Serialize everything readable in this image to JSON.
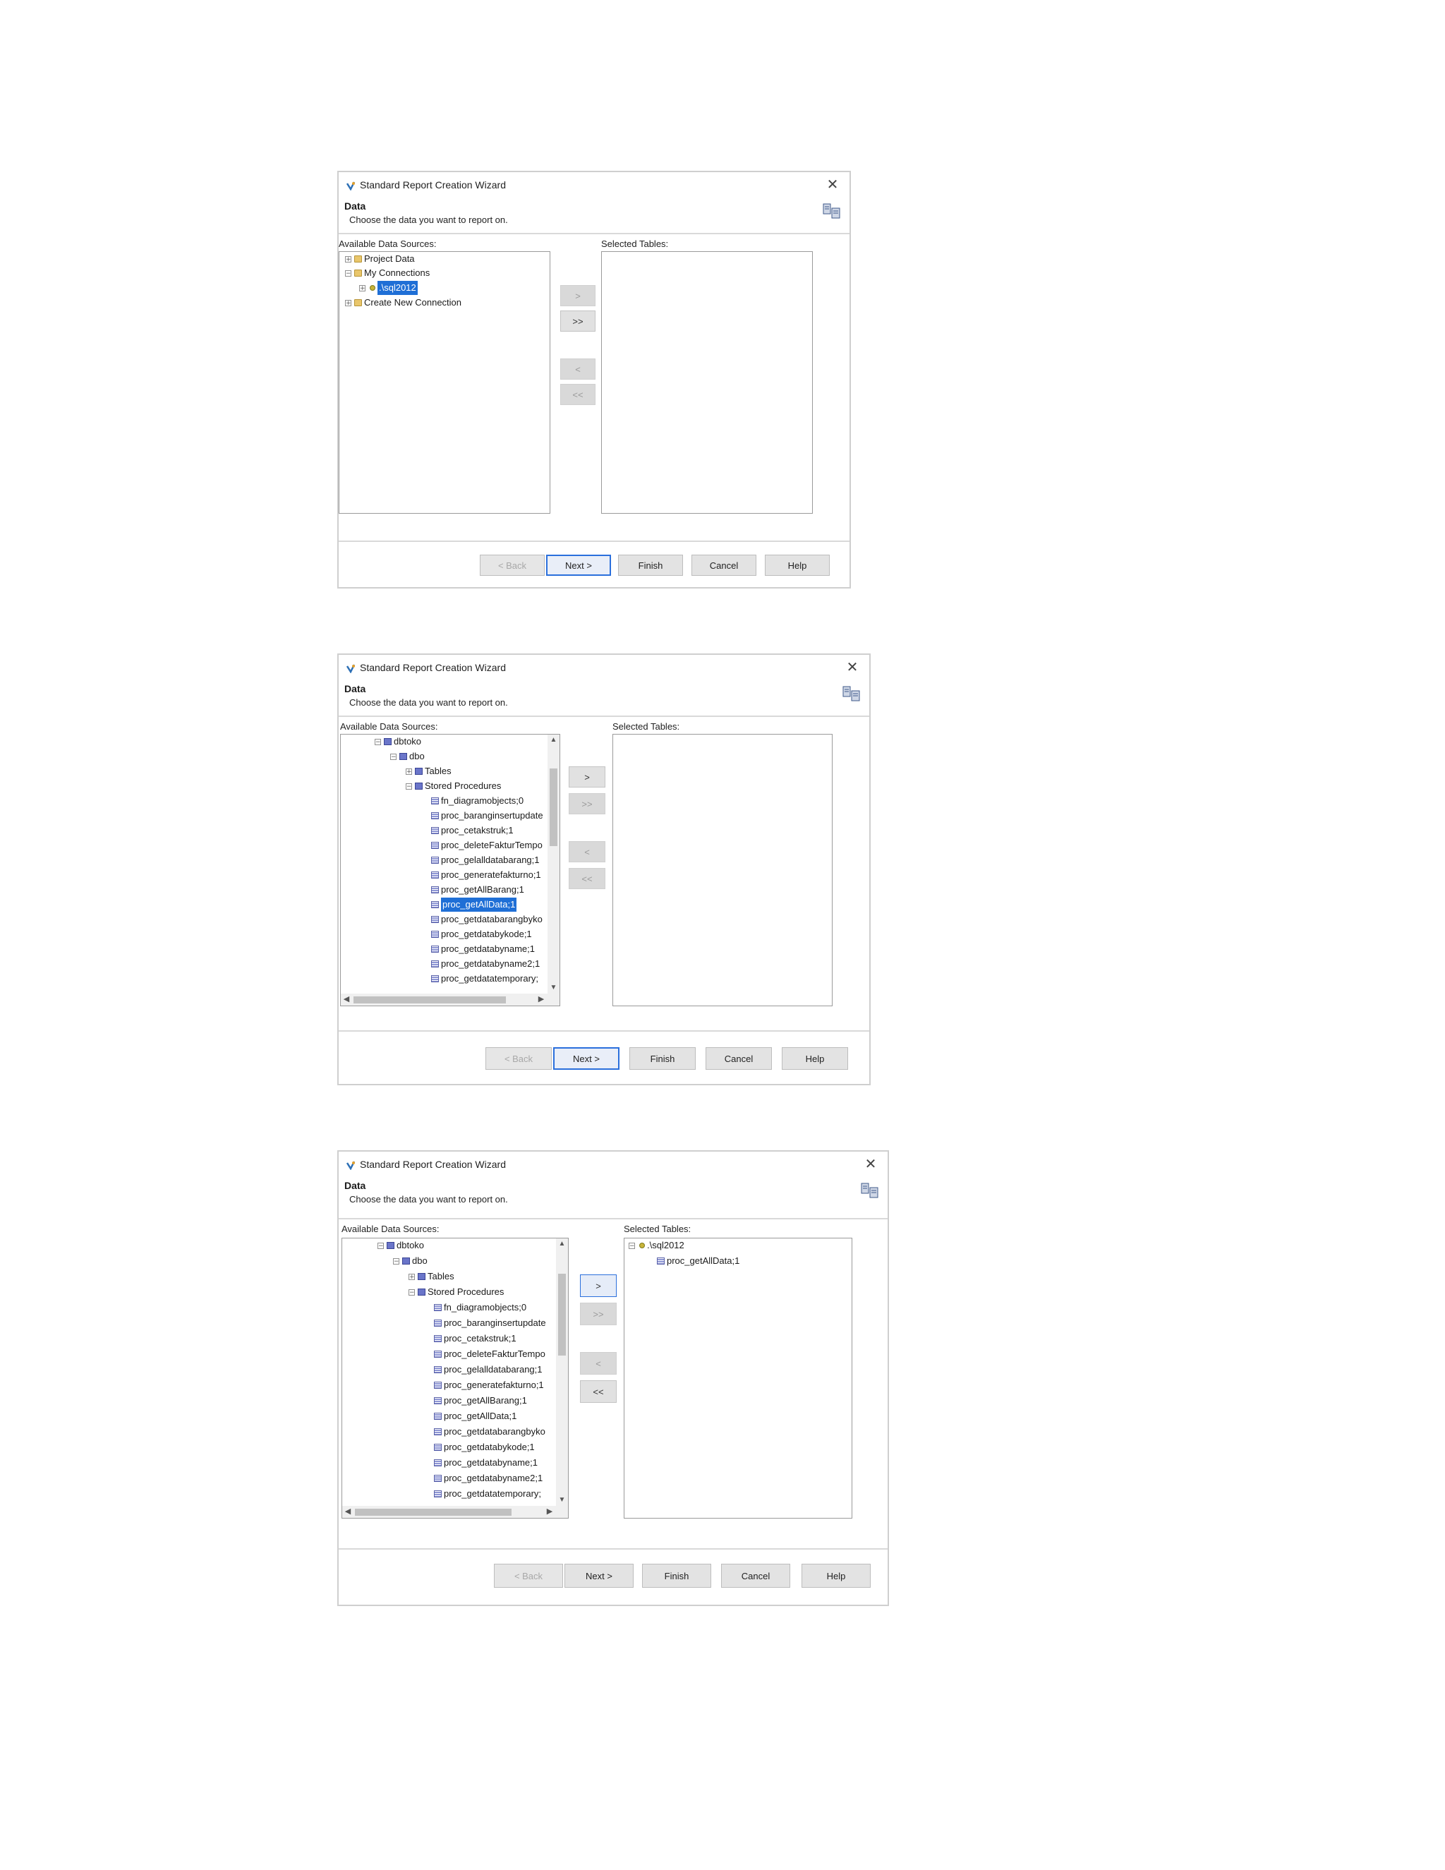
{
  "dialog_title": "Standard Report Creation Wizard",
  "header_title": "Data",
  "header_subtitle": "Choose the data you want to report on.",
  "available_label": "Available Data Sources:",
  "selected_label": "Selected Tables:",
  "arrows": {
    "add": ">",
    "add_all": ">>",
    "remove": "<",
    "remove_all": "<<"
  },
  "footer": {
    "back": "< Back",
    "next": "Next >",
    "finish": "Finish",
    "cancel": "Cancel",
    "help": "Help"
  },
  "dialog1": {
    "tree": [
      "Project Data",
      "My Connections",
      ".\\sql2012",
      "Create New Connection"
    ]
  },
  "tree_db": {
    "db": "dbtoko",
    "schema": "dbo",
    "tables": "Tables",
    "sp": "Stored Procedures",
    "procs": [
      "fn_diagramobjects;0",
      "proc_baranginsertupdate",
      "proc_cetakstruk;1",
      "proc_deleteFakturTempo",
      "proc_gelalldatabarang;1",
      "proc_generatefakturno;1",
      "proc_getAllBarang;1",
      "proc_getAllData;1",
      "proc_getdatabarangbyko",
      "proc_getdatabykode;1",
      "proc_getdatabyname;1",
      "proc_getdatabyname2;1",
      "proc_getdatatemporary;"
    ]
  },
  "dialog3": {
    "selected_server": ".\\sql2012",
    "selected_item": "proc_getAllData;1"
  }
}
